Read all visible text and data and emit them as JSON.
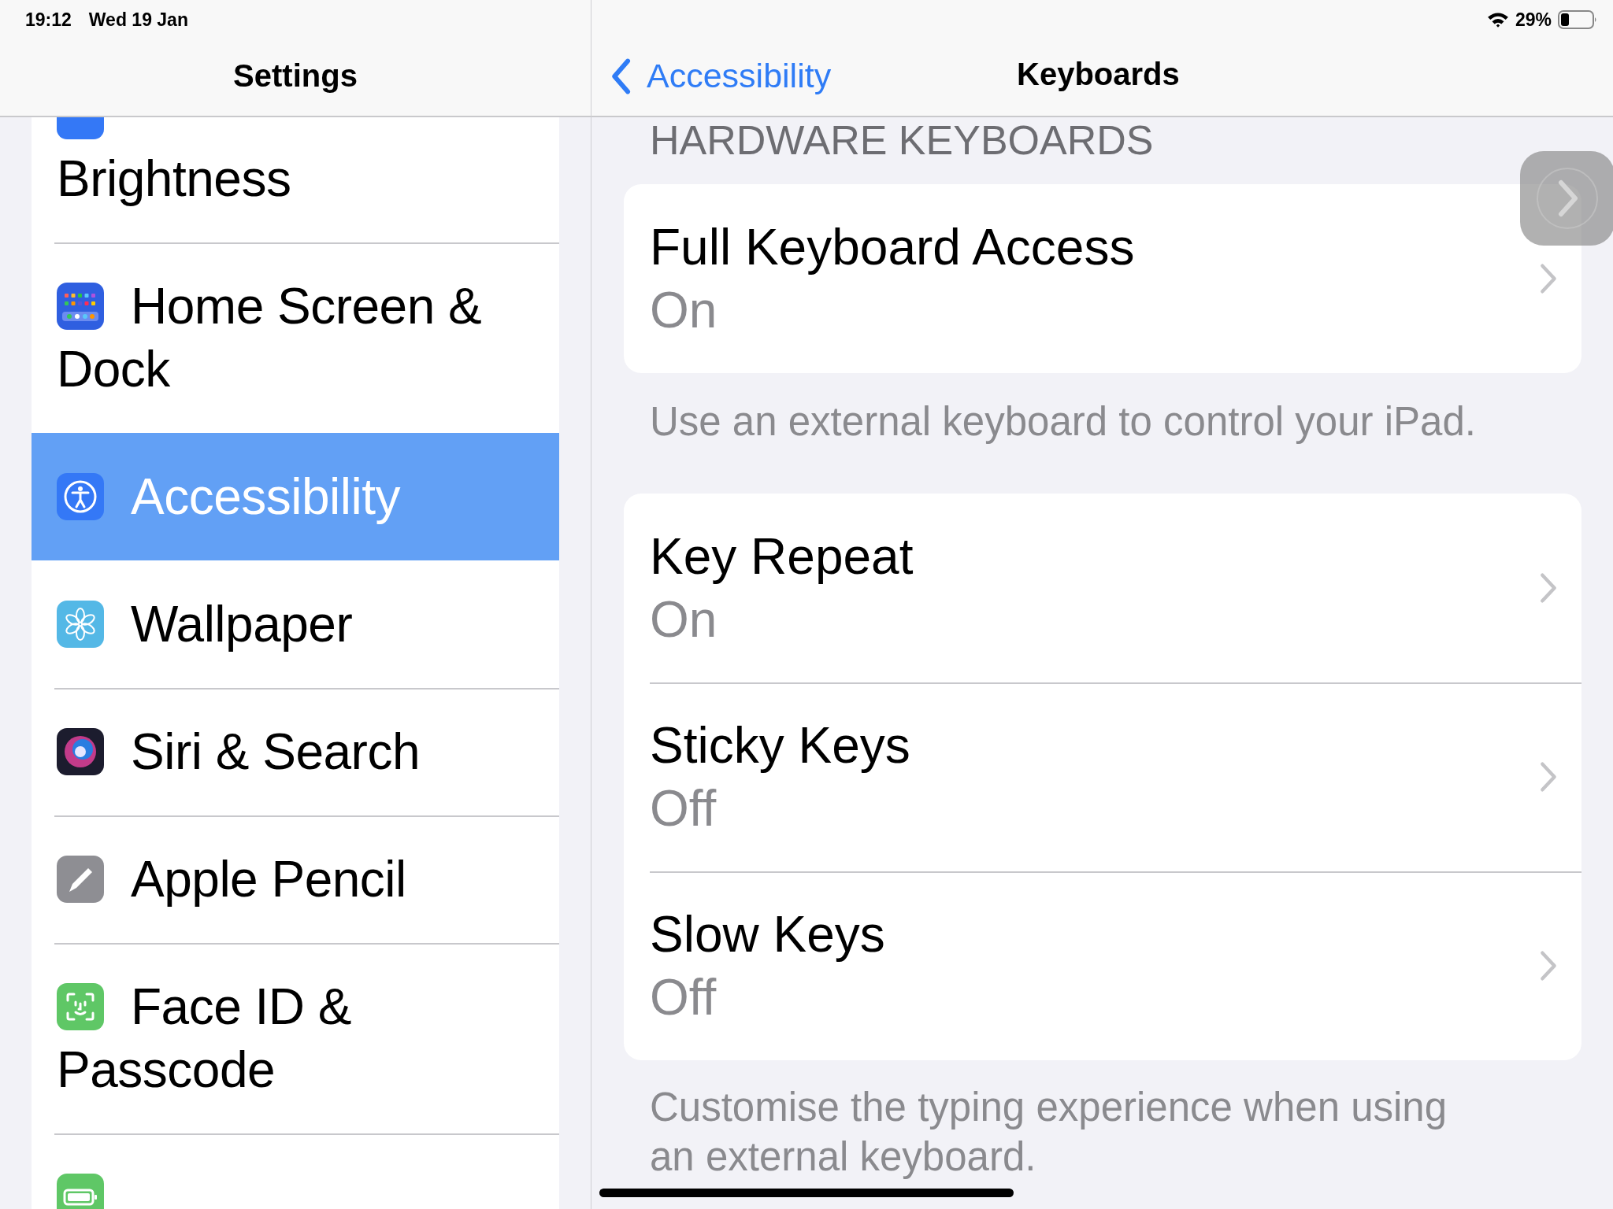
{
  "status_bar": {
    "time": "19:12",
    "date": "Wed 19 Jan",
    "battery_percent": "29%"
  },
  "sidebar": {
    "title": "Settings",
    "items": [
      {
        "label": "Brightness",
        "color": "#3478f6",
        "selected": false
      },
      {
        "label": "Home Screen & Dock",
        "color": "#2f5fe0",
        "selected": false
      },
      {
        "label": "Accessibility",
        "color": "#3478f6",
        "selected": true
      },
      {
        "label": "Wallpaper",
        "color": "#54b8e6",
        "selected": false
      },
      {
        "label": "Siri & Search",
        "color": "#1c1c2e",
        "selected": false
      },
      {
        "label": "Apple Pencil",
        "color": "#8e8e93",
        "selected": false
      },
      {
        "label": "Face ID & Passcode",
        "color": "#5fc766",
        "selected": false
      },
      {
        "color": "#5fc766",
        "selected": false
      }
    ]
  },
  "detail": {
    "back_label": "Accessibility",
    "title": "Keyboards",
    "section_header": "HARDWARE KEYBOARDS",
    "groups": [
      {
        "rows": [
          {
            "title": "Full Keyboard Access",
            "value": "On"
          }
        ],
        "footer": "Use an external keyboard to control your iPad."
      },
      {
        "rows": [
          {
            "title": "Key Repeat",
            "value": "On"
          },
          {
            "title": "Sticky Keys",
            "value": "Off"
          },
          {
            "title": "Slow Keys",
            "value": "Off"
          }
        ],
        "footer": "Customise the typing experience when using an external keyboard."
      }
    ]
  }
}
